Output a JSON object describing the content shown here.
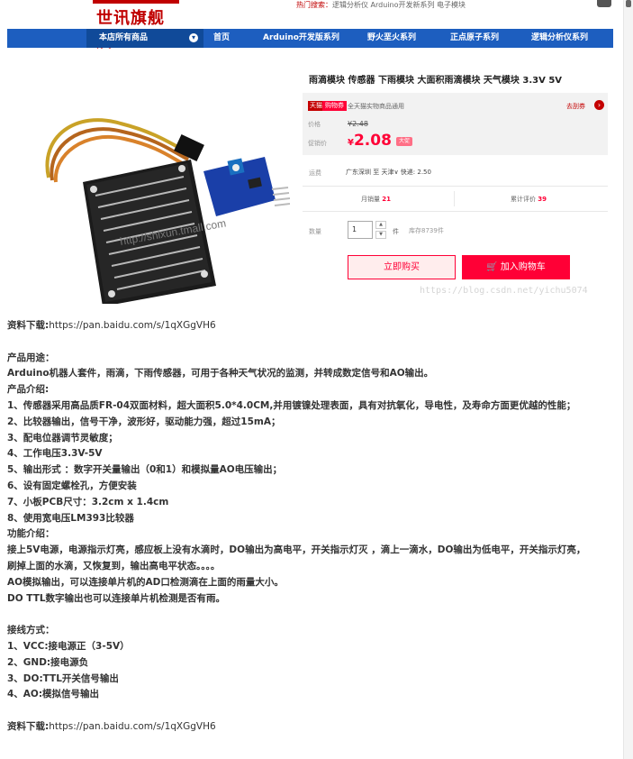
{
  "header": {
    "logo_text": "世讯旗舰店",
    "hot_search_label": "热门搜索：",
    "hot_search_terms": "逻辑分析仪 Arduino开发新系列 电子模块"
  },
  "nav": {
    "dropdown_label": "本店所有商品",
    "items": [
      "首页",
      "Arduino开发版系列",
      "野火垩火系列",
      "正点原子系列",
      "逻辑分析仪系列"
    ]
  },
  "product": {
    "title": "雨滴模块 传感器 下雨模块 大面积雨滴模块 天气模块 3.3V 5V",
    "promo_tag1": "天猫",
    "promo_tag2": "购物券",
    "promo_text": "全天猫实物商品通用",
    "goto_link": "去刮券",
    "price_label": "价格",
    "price_old": "¥2.48",
    "promo_label": "促销价",
    "promo_price_yen": "¥",
    "promo_price": "2.08",
    "promo_badge": "大促",
    "ship_label": "运费",
    "ship_info": "广东深圳  至 天津∨  快递: 2.50",
    "monthly_label": "月销量",
    "monthly_value": "21",
    "reviews_label": "累计评价",
    "reviews_value": "39",
    "qty_label": "数量",
    "qty_value": "1",
    "qty_unit": "件",
    "stock": "库存8739件",
    "buy_now": "立即购买",
    "add_cart": "加入购物车",
    "watermark": "https://blog.csdn.net/yichu5074"
  },
  "article": {
    "download_label": "资料下载:",
    "download_url": "https://pan.baidu.com/s/1qXGgVH6",
    "lines": [
      "产品用途：",
      "Arduino机器人套件，雨滴，下雨传感器，可用于各种天气状况的监测，并转成数定信号和AO输出。",
      "产品介绍:",
      "1、传感器采用高品质FR-04双面材料，超大面积5.0*4.0CM,并用镀镍处理表面，具有对抗氧化，导电性，及寿命方面更优越的性能；",
      "2、比较器输出，信号干净，波形好，驱动能力强，超过15mA；",
      "3、配电位器调节灵敏度；",
      "4、工作电压3.3V-5V",
      "5、输出形式 ：数字开关量输出（0和1）和模拟量AO电压输出；",
      "6、设有固定螺栓孔，方便安装",
      "7、小板PCB尺寸：3.2cm x 1.4cm",
      "8、使用宽电压LM393比较器",
      "功能介绍：",
      "接上5V电源，电源指示灯亮，感应板上没有水滴时，DO输出为高电平，开关指示灯灭 ，滴上一滴水，DO输出为低电平，开关指示灯亮，",
      "刷掉上面的水滴，又恢复到，输出高电平状态。。。。",
      "AO模拟输出，可以连接单片机的AD口检测滴在上面的雨量大小。",
      "DO TTL数字输出也可以连接单片机检测是否有雨。"
    ],
    "wiring_lines": [
      "接线方式：",
      "1、VCC:接电源正（3-5V）",
      "2、GND:接电源负",
      "3、DO:TTL开关信号输出",
      "4、AO:模拟信号输出"
    ]
  }
}
